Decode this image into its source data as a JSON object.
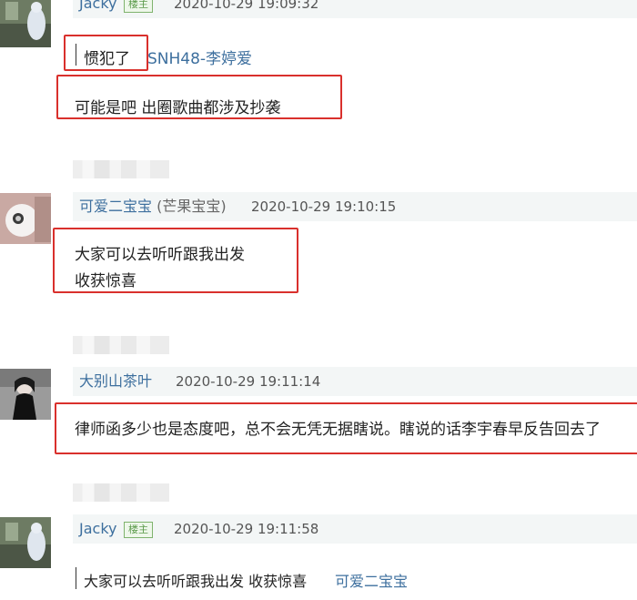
{
  "comments": [
    {
      "username": "Jacky",
      "badge": "楼主",
      "time": "2020-10-29 19:09:32",
      "quote_text": "惯犯了",
      "quote_reply_to": "SNH48-李婷爱",
      "reply_text": "可能是吧 出圈歌曲都涉及抄袭"
    },
    {
      "username": "可爱二宝宝",
      "user_tag": "(芒果宝宝)",
      "time": "2020-10-29 19:10:15",
      "text_line1": "大家可以去听听跟我出发",
      "text_line2": "收获惊喜"
    },
    {
      "username": "大别山茶叶",
      "time": "2020-10-29 19:11:14",
      "text": "律师函多少也是态度吧，总不会无凭无据瞎说。瞎说的话李宇春早反告回去了"
    },
    {
      "username": "Jacky",
      "badge": "楼主",
      "time": "2020-10-29 19:11:58",
      "quote_text": "大家可以去听听跟我出发 收获惊喜",
      "quote_reply_to": "可爱二宝宝"
    }
  ],
  "colors": {
    "highlight_box": "#d9302c",
    "username": "#3d6f9e",
    "header_bg": "#f3f6f6"
  }
}
